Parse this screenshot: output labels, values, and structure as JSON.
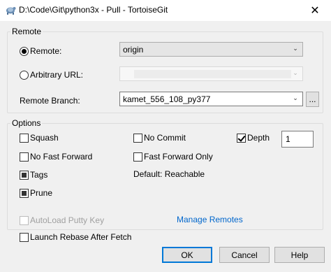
{
  "window": {
    "title": "D:\\Code\\Git\\python3x - Pull - TortoiseGit",
    "close_glyph": "✕"
  },
  "remote_group": {
    "legend": "Remote",
    "remote_label": "Remote:",
    "remote_value": "origin",
    "url_label": "Arbitrary URL:",
    "url_value": "",
    "branch_label": "Remote Branch:",
    "branch_value": "kamet_556_108_py377",
    "browse_label": "..."
  },
  "options_group": {
    "legend": "Options",
    "squash": "Squash",
    "no_commit": "No Commit",
    "depth": "Depth",
    "depth_value": "1",
    "no_fast_forward": "No Fast Forward",
    "fast_forward_only": "Fast Forward Only",
    "tags": "Tags",
    "default_reachable": "Default: Reachable",
    "prune": "Prune"
  },
  "footer": {
    "autoload": "AutoLoad Putty Key",
    "manage_remotes": "Manage Remotes",
    "launch_rebase": "Launch Rebase After Fetch",
    "ok": "OK",
    "cancel": "Cancel",
    "help": "Help"
  },
  "icons": {
    "chevron": "chevron-down-icon",
    "app": "tortoisegit-icon"
  },
  "colors": {
    "link": "#0066cc",
    "default_button_border": "#0078d7"
  }
}
